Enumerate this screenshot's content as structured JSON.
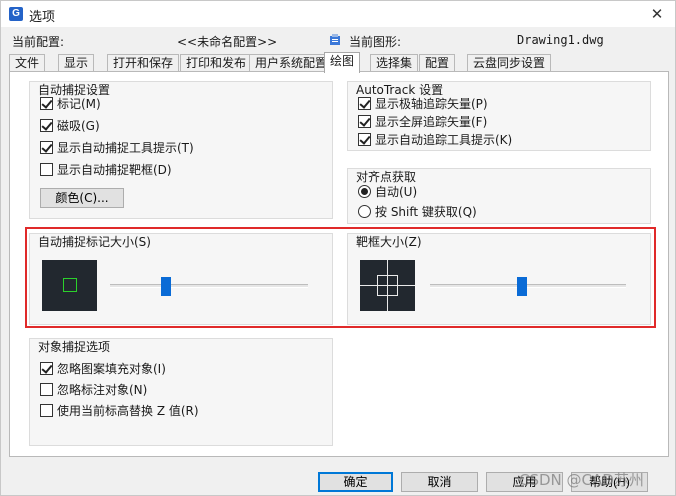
{
  "window": {
    "title": "选项",
    "app_icon_letter": "G",
    "close_glyph": "✕"
  },
  "config": {
    "current_profile_label": "当前配置:",
    "current_profile_value": "<<未命名配置>>",
    "current_drawing_label": "当前图形:",
    "current_drawing_value": "Drawing1.dwg"
  },
  "tabs": [
    {
      "label": "文件"
    },
    {
      "label": "显示"
    },
    {
      "label": "打开和保存"
    },
    {
      "label": "打印和发布"
    },
    {
      "label": "用户系统配置"
    },
    {
      "label": "绘图",
      "active": true
    },
    {
      "label": "选择集"
    },
    {
      "label": "配置"
    },
    {
      "label": "云盘同步设置"
    }
  ],
  "autosnap": {
    "title": "自动捕捉设置",
    "marker": {
      "label": "标记(M)",
      "checked": true
    },
    "magnet": {
      "label": "磁吸(G)",
      "checked": true
    },
    "tooltip": {
      "label": "显示自动捕捉工具提示(T)",
      "checked": true
    },
    "aperture_box": {
      "label": "显示自动捕捉靶框(D)",
      "checked": false
    },
    "color_button": "颜色(C)..."
  },
  "autotrack": {
    "title": "AutoTrack 设置",
    "polar": {
      "label": "显示极轴追踪矢量(P)",
      "checked": true
    },
    "fullscreen": {
      "label": "显示全屏追踪矢量(F)",
      "checked": true
    },
    "tooltip": {
      "label": "显示自动追踪工具提示(K)",
      "checked": true
    }
  },
  "alignment": {
    "title": "对齐点获取",
    "auto": {
      "label": "自动(U)",
      "selected": true
    },
    "shift": {
      "label": "按 Shift 键获取(Q)",
      "selected": false
    }
  },
  "marker_size": {
    "title": "自动捕捉标记大小(S)",
    "slider_fraction": 0.27
  },
  "aperture_size": {
    "title": "靶框大小(Z)",
    "slider_fraction": 0.47
  },
  "object_snap": {
    "title": "对象捕捉选项",
    "ignore_hatch": {
      "label": "忽略图案填充对象(I)",
      "checked": true
    },
    "ignore_dim": {
      "label": "忽略标注对象(N)",
      "checked": false
    },
    "replace_z": {
      "label": "使用当前标高替换 Z 值(R)",
      "checked": false
    }
  },
  "buttons": {
    "ok": "确定",
    "cancel": "取消",
    "apply": "应用",
    "help": "帮助(H)"
  },
  "watermark": "CSDN @CAD苏州",
  "colors": {
    "accent": "#0a6bd6",
    "highlight_border": "#e02a2a",
    "marker_green": "#2bd12b",
    "preview_bg": "#22282f"
  }
}
